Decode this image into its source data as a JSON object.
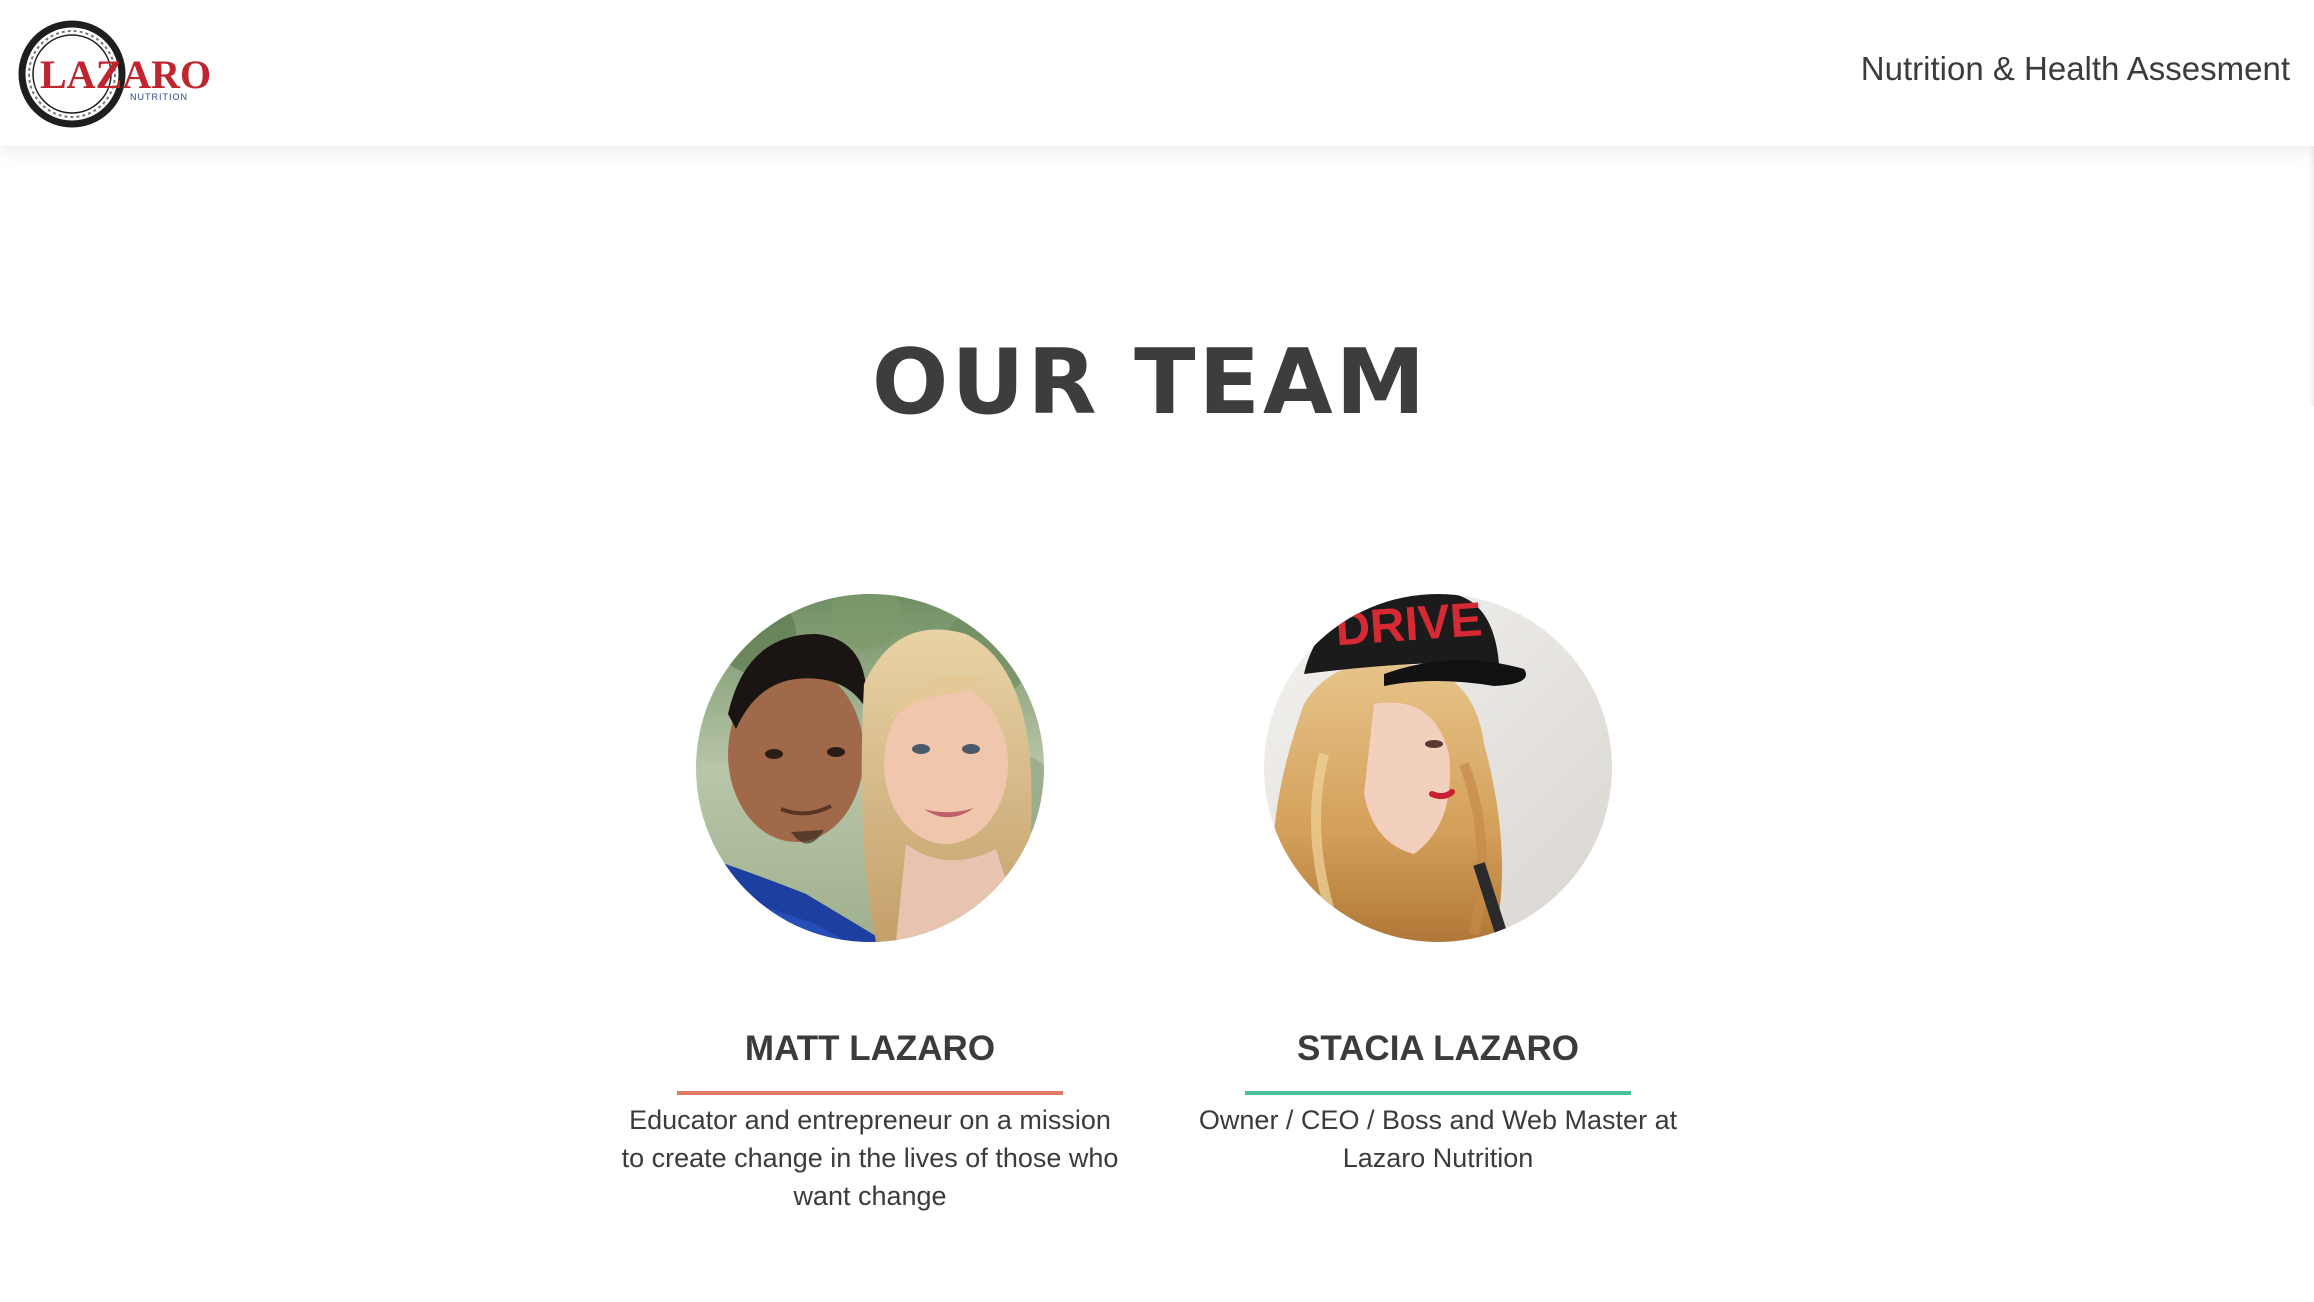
{
  "header": {
    "logo": {
      "text": "LAZARO",
      "subtext": "NUTRITION"
    },
    "nav_link": "Nutrition & Health Assesment"
  },
  "main": {
    "title": "OUR TEAM",
    "members": [
      {
        "name": "MATT LAZARO",
        "description": "Educator and entrepreneur on a mission to create change in the lives of those who want change",
        "accent_color": "#e07a62",
        "photo": "matt-and-stacia-selfie"
      },
      {
        "name": "STACIA LAZARO",
        "description": "Owner / CEO / Boss and Web Master at Lazaro Nutrition",
        "accent_color": "#4bbf9b",
        "photo": "stacia-portrait-drive-cap"
      }
    ]
  },
  "colors": {
    "logo_red": "#c0242c",
    "text": "#3b3b3b"
  }
}
